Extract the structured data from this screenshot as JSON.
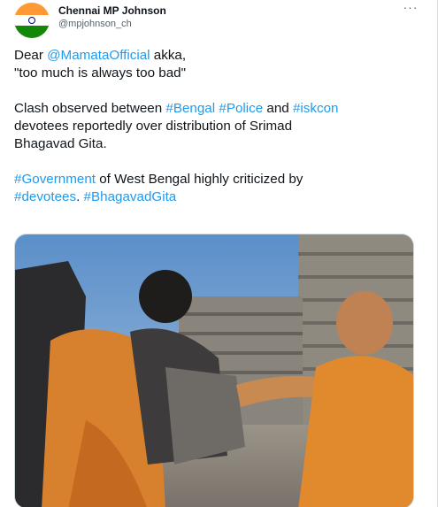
{
  "author": {
    "name": "Chennai MP Johnson",
    "handle": "@mpjohnson_ch",
    "avatar_icon": "indian-flag-avatar"
  },
  "menu": {
    "more_label": "···"
  },
  "tweet": {
    "l1_a": "Dear ",
    "l1_mention": "@MamataOfficial",
    "l1_b": " akka,",
    "l2": "\"too much is always too bad\"",
    "l3_a": "Clash observed between ",
    "l3_tag1": "#Bengal",
    "l3_sp1": " ",
    "l3_tag2": "#Police",
    "l3_b": " and ",
    "l3_tag3": "#iskcon",
    "l4": "devotees reportedly over distribution of Srimad",
    "l5": "Bhagavad Gita.",
    "l6_tag": "#Government",
    "l6_b": " of West Bengal highly criticized by",
    "l7_tag1": "#devotees",
    "l7_b": ". ",
    "l7_tag2": "#BhagavadGita"
  },
  "media": {
    "type": "video-thumbnail",
    "description_icon": "video-still"
  },
  "colors": {
    "link": "#1d9bf0",
    "text": "#0f1419",
    "secondary": "#536471",
    "border": "#cfd9de"
  }
}
